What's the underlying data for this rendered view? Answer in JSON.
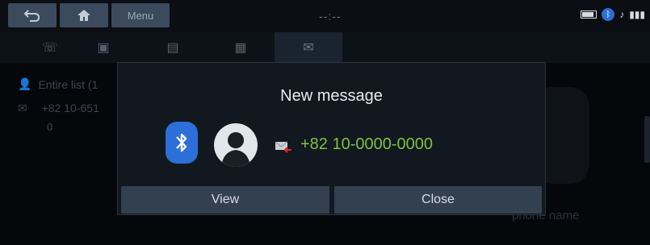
{
  "topbar": {
    "menu_label": "Menu",
    "clock": "--:--"
  },
  "tabs": [
    {
      "icon": "call-history-icon"
    },
    {
      "icon": "contacts-icon"
    },
    {
      "icon": "favorites-icon"
    },
    {
      "icon": "keypad-icon"
    },
    {
      "icon": "messages-icon",
      "active": true
    }
  ],
  "background_list": {
    "header": "Entire list (1",
    "item_number": "+82 10-651",
    "item_sub": "0",
    "phone_name_label": "phone name"
  },
  "popup": {
    "title": "New message",
    "phone_number": "+82 10-0000-0000",
    "view_label": "View",
    "close_label": "Close"
  },
  "colors": {
    "accent_green": "#7cc243",
    "bluetooth_blue": "#2d6fd8",
    "button_bg": "#33404f"
  }
}
